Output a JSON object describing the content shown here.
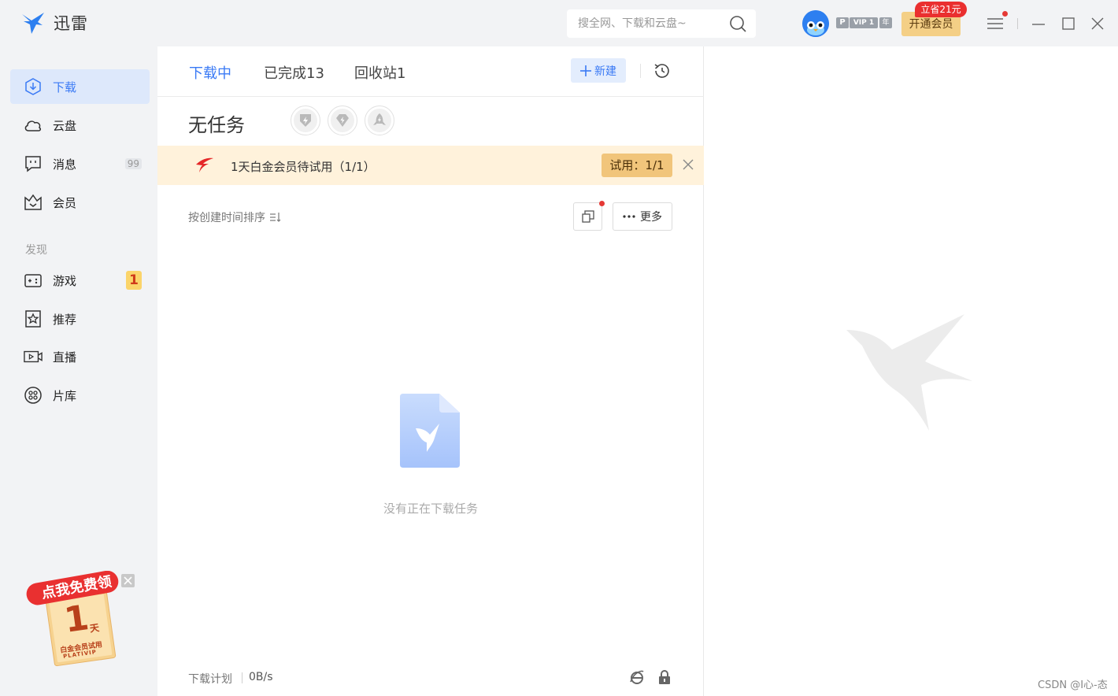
{
  "app": {
    "name": "迅雷"
  },
  "search": {
    "placeholder": "搜全网、下载和云盘~"
  },
  "account": {
    "badge_p": "P",
    "badge_vip": "VIP 1",
    "badge_year": "年",
    "open_vip_label": "开通会员",
    "promo_tag": "立省21元"
  },
  "sidebar": {
    "items": [
      {
        "label": "下载",
        "icon": "download-icon"
      },
      {
        "label": "云盘",
        "icon": "cloud-icon"
      },
      {
        "label": "消息",
        "icon": "message-icon",
        "count": "99"
      },
      {
        "label": "会员",
        "icon": "crown-icon"
      }
    ],
    "discover_title": "发现",
    "discover_items": [
      {
        "label": "游戏",
        "icon": "gamepad-icon",
        "badge": "1"
      },
      {
        "label": "推荐",
        "icon": "star-icon"
      },
      {
        "label": "直播",
        "icon": "live-icon"
      },
      {
        "label": "片库",
        "icon": "film-reel-icon"
      }
    ],
    "promo": {
      "headline": "点我免费领",
      "days": "1",
      "day_unit": "天",
      "subtitle": "白金会员试用",
      "brand": "PLATIVIP"
    }
  },
  "main": {
    "tabs": [
      {
        "label": "下载中",
        "active": true
      },
      {
        "label": "已完成13"
      },
      {
        "label": "回收站1"
      }
    ],
    "new_label": "新建",
    "status_title": "无任务",
    "trial": {
      "text": "1天白金会员待试用（1/1）",
      "pill": "试用：1/1"
    },
    "sort_label": "按创建时间排序",
    "more_label": "更多",
    "empty_text": "没有正在下载任务",
    "footer": {
      "plan_label": "下载计划",
      "speed": "0B/s"
    }
  },
  "watermark": {
    "credit": "CSDN @I心-态"
  },
  "colors": {
    "accent": "#3a7af5",
    "sidebar_bg": "#f2f3f5",
    "vip_gold": "#f4cf86",
    "banner_bg": "#fff2db",
    "promo_red": "#ea2f2f"
  }
}
